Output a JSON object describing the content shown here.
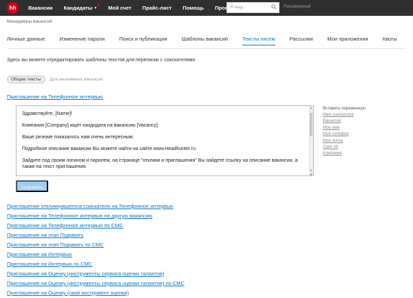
{
  "topbar": {
    "logo": "hh",
    "nav": [
      {
        "label": "Вакансии"
      },
      {
        "label": "Кандидаты"
      },
      {
        "label": "Мой счет"
      },
      {
        "label": "Прайс-лист"
      },
      {
        "label": "Помощь"
      },
      {
        "label": "Проекты"
      }
    ],
    "search_placeholder": "Я ищу...",
    "advanced_search": "Расширенный"
  },
  "breadcrumb": "Менеджеры вакансий",
  "tabs": [
    {
      "label": "Личные данные"
    },
    {
      "label": "Изменение пароля"
    },
    {
      "label": "Поиск и публикация"
    },
    {
      "label": "Шаблоны вакансий"
    },
    {
      "label": "Тексты писем",
      "active": true
    },
    {
      "label": "Рассылки"
    },
    {
      "label": "Мои приложения"
    },
    {
      "label": "Квоты"
    }
  ],
  "intro": "Здесь вы можете отредактировать шаблоны текстов для переписки с соискателями",
  "filter": {
    "active": "Общие тексты",
    "inactive": "Для анонимных вакансий"
  },
  "main_link": "Приглашение на Телефонное интервью",
  "editor": {
    "paragraphs": [
      "Здравствуйте, [Name]!",
      "Компания [Company] ищет кандидата на вакансию [Vacancy].",
      "Ваше резюме показалось нам очень интересным.",
      "Подробное описание вакансии Вы можете найти на сайте www.Headhunter.ru",
      "Зайдите под своим логином и паролем, на странице \"отклики и приглашения\" Вы найдете ссылку на описание вакансии, а также на текст приглашения."
    ]
  },
  "variables": {
    "title": "Вставить переменную",
    "items": [
      "Имя соискателя",
      "Вакансия",
      "Мое имя",
      "Мой телефон",
      "Моя почта",
      "Сайт hh",
      "Компания"
    ]
  },
  "save_label": "Сохранить",
  "links": [
    "Приглашение откликнувшегося соискателя на Телефонное интервью",
    "Приглашение на Телефонное интервью на другую вакансию",
    "Приглашение на Телефонное интервью по СМС",
    "Приглашение на этап Подумать",
    "Приглашение на этап Подумать по СМС",
    "Приглашение на Интервью",
    "Приглашение на Интервью по СМС",
    "Приглашение на Оценку (инструменты сервиса оценки талантов)",
    "Приглашение на Оценку (инструменты сервиса оценки талантов) по СМС",
    "Приглашение на Оценку (свой инструмент оценки)"
  ],
  "colors": {
    "accent": "#0b74c4",
    "brand": "#d6001c",
    "topbar": "#2f2f2f"
  }
}
